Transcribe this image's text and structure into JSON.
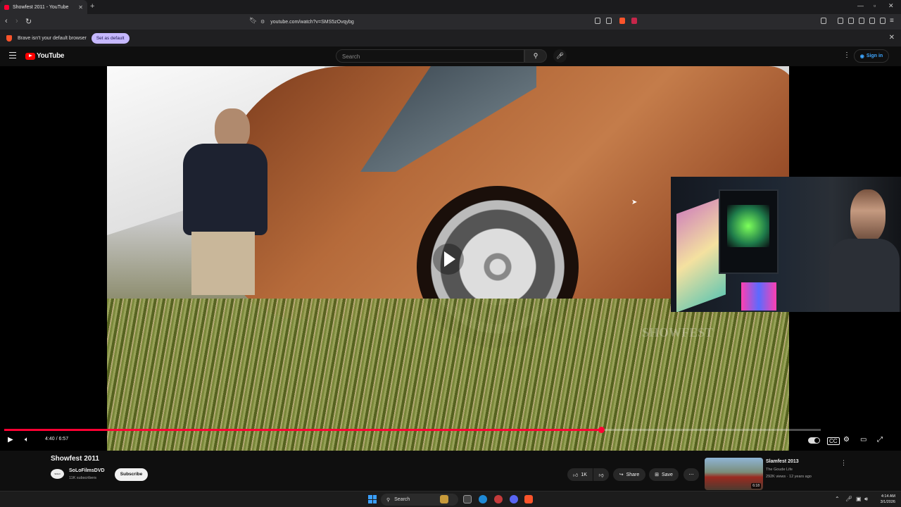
{
  "browser": {
    "tab_title": "Showfest 2011 - YouTube",
    "url": "youtube.com/watch?v=SMS5zOvqybg",
    "infobar_text": "Brave isn't your default browser",
    "set_default_label": "Set as default"
  },
  "youtube": {
    "logo_text": "YouTube",
    "search_placeholder": "Search",
    "sign_in_label": "Sign in"
  },
  "player": {
    "time_display": "4:40 / 6:57",
    "progress": 0.731,
    "watermark": "SHOWFEST"
  },
  "video": {
    "title": "Showfest 2011",
    "channel_name": "SoLoFilmsDVD",
    "channel_subs": "11K subscribers",
    "avatar_text": "SOLO",
    "subscribe_label": "Subscribe",
    "like_count": "1K",
    "share_label": "Share",
    "save_label": "Save"
  },
  "recommendation": {
    "title": "Slamfest 2013",
    "channel": "The Goude Life",
    "meta": "292K views · 12 years ago",
    "duration": "6:18"
  },
  "taskbar": {
    "search_label": "Search",
    "time": "4:14 AM",
    "date": "3/1/2026"
  },
  "colors": {
    "youtube_red": "#ff0000",
    "progress_red": "#ff0033",
    "brave_orange": "#fb542b",
    "link_blue": "#3ea6ff"
  }
}
